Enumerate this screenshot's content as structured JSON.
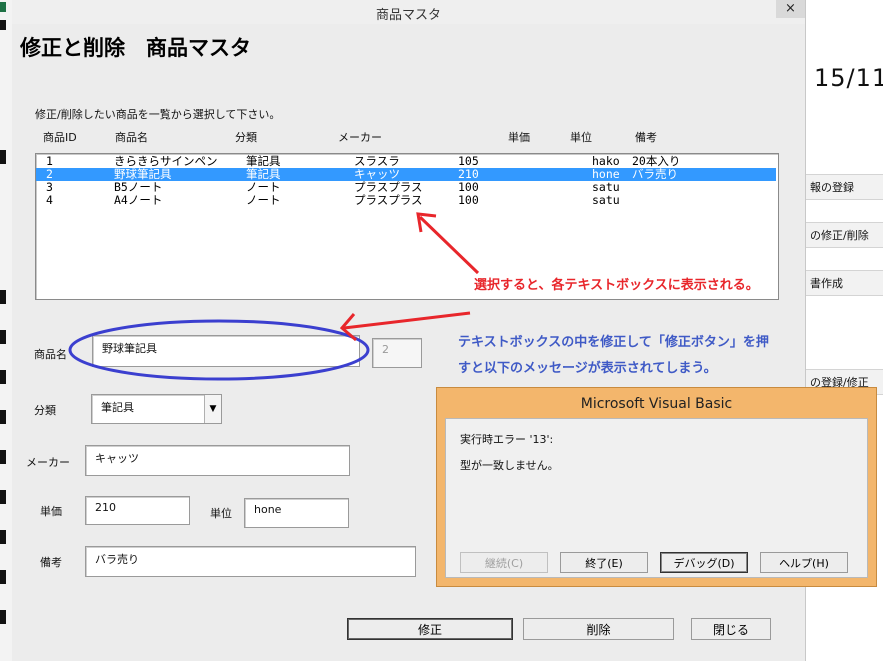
{
  "window": {
    "title": "商品マスタ",
    "close_glyph": "×"
  },
  "background": {
    "date_text": "15/11/",
    "side_buttons": [
      "報の登録",
      "の修正/削除",
      "書作成",
      "の登録/修正"
    ]
  },
  "form": {
    "heading": "修正と削除　商品マスタ",
    "instruction": "修正/削除したい商品を一覧から選択して下さい。",
    "columns": [
      "商品ID",
      "商品名",
      "分類",
      "メーカー",
      "単価",
      "単位",
      "備考"
    ],
    "items": [
      {
        "id": "1",
        "name": "きらきらサインペン",
        "category": "筆記具",
        "maker": "スラスラ",
        "price": "105",
        "unit": "hako",
        "note": "20本入り"
      },
      {
        "id": "2",
        "name": "野球筆記具",
        "category": "筆記具",
        "maker": "キャッツ",
        "price": "210",
        "unit": "hone",
        "note": "バラ売り"
      },
      {
        "id": "3",
        "name": "B5ノート",
        "category": "ノート",
        "maker": "プラスプラス",
        "price": "100",
        "unit": "satu",
        "note": ""
      },
      {
        "id": "4",
        "name": "A4ノート",
        "category": "ノート",
        "maker": "プラスプラス",
        "price": "100",
        "unit": "satu",
        "note": ""
      }
    ],
    "selected_index": 1,
    "fields": {
      "name_label": "商品名",
      "name_value": "野球筆記具",
      "id_value": "2",
      "category_label": "分類",
      "category_value": "筆記具",
      "maker_label": "メーカー",
      "maker_value": "キャッツ",
      "price_label": "単価",
      "price_value": "210",
      "unit_label": "単位",
      "unit_value": "hone",
      "note_label": "備考",
      "note_value": "バラ売り"
    },
    "buttons": {
      "modify": "修正",
      "delete": "削除",
      "close": "閉じる"
    }
  },
  "annotations": {
    "red_text": "選択すると、各テキストボックスに表示される。",
    "blue_text": "テキストボックスの中を修正して「修正ボタン」を押すと以下のメッセージが表示されてしまう。",
    "red_color": "#e8262b",
    "blue_color": "#3f5ac6"
  },
  "dialog": {
    "title": "Microsoft Visual Basic",
    "line1": "実行時エラー '13':",
    "line2": "型が一致しません。",
    "buttons": {
      "continue": "継続(C)",
      "end": "終了(E)",
      "debug": "デバッグ(D)",
      "help": "ヘルプ(H)"
    }
  }
}
